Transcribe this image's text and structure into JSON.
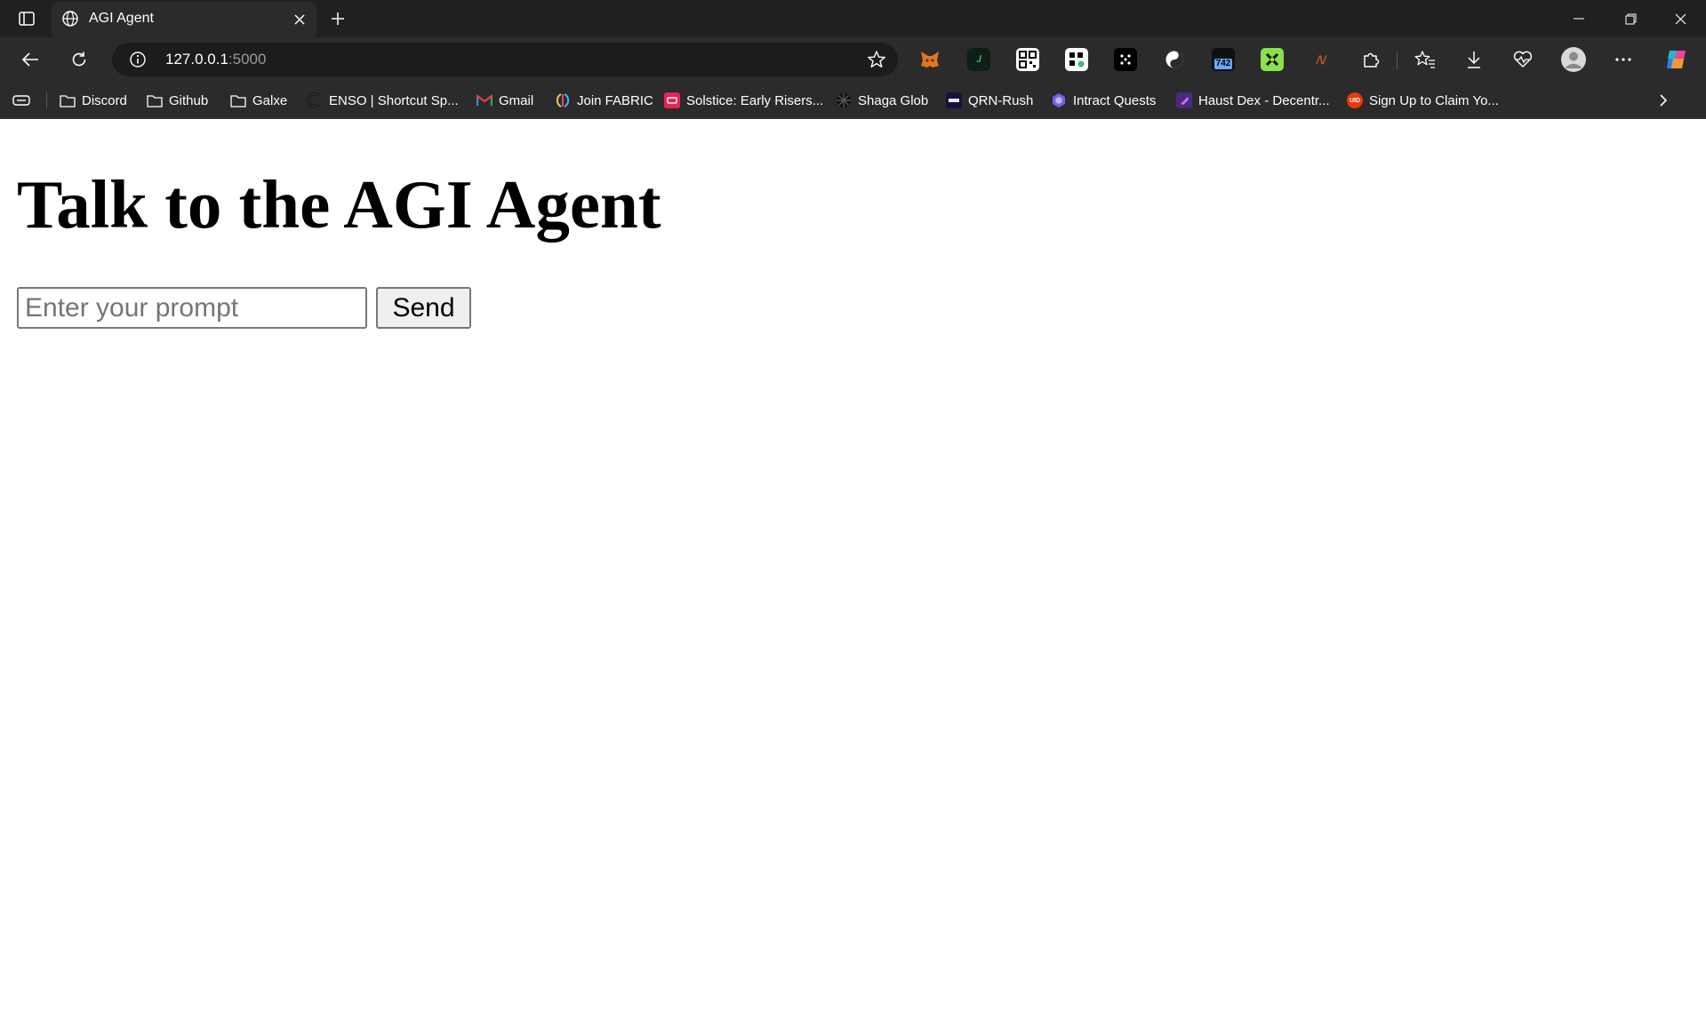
{
  "browser": {
    "tab": {
      "title": "AGI Agent",
      "favicon": "globe-icon"
    },
    "address": {
      "host": "127.0.0.1",
      "port": ":5000"
    },
    "extensions": [
      "metamask-fox-icon",
      "slash-terminal-icon",
      "qr-code-icon",
      "grid-dots-icon",
      "dice-icon",
      "yin-yang-icon",
      "calendar-badge-icon",
      "green-cross-icon",
      "waves-icon"
    ],
    "extension_badge": "742",
    "bookmarks": [
      {
        "label": "Discord",
        "icon": "folder-icon"
      },
      {
        "label": "Github",
        "icon": "folder-icon"
      },
      {
        "label": "Galxe",
        "icon": "folder-icon"
      },
      {
        "label": "ENSO | Shortcut Sp...",
        "icon": "enso-icon"
      },
      {
        "label": "Gmail",
        "icon": "gmail-icon"
      },
      {
        "label": "Join FABRIC",
        "icon": "fabric-icon"
      },
      {
        "label": "Solstice: Early Risers...",
        "icon": "solstice-icon"
      },
      {
        "label": "Shaga Glob",
        "icon": "shaga-icon"
      },
      {
        "label": "QRN-Rush",
        "icon": "qrn-icon"
      },
      {
        "label": "Intract Quests",
        "icon": "intract-icon"
      },
      {
        "label": "Haust Dex - Decentr...",
        "icon": "haust-icon"
      },
      {
        "label": "Sign Up to Claim Yo...",
        "icon": "uid-icon"
      }
    ],
    "colors": {
      "tabstrip": "#202020",
      "toolbar": "#2b2b2b",
      "omnibox": "#1c1c1c"
    }
  },
  "page": {
    "heading": "Talk to the AGI Agent",
    "input": {
      "placeholder": "Enter your prompt",
      "value": ""
    },
    "send_label": "Send"
  }
}
